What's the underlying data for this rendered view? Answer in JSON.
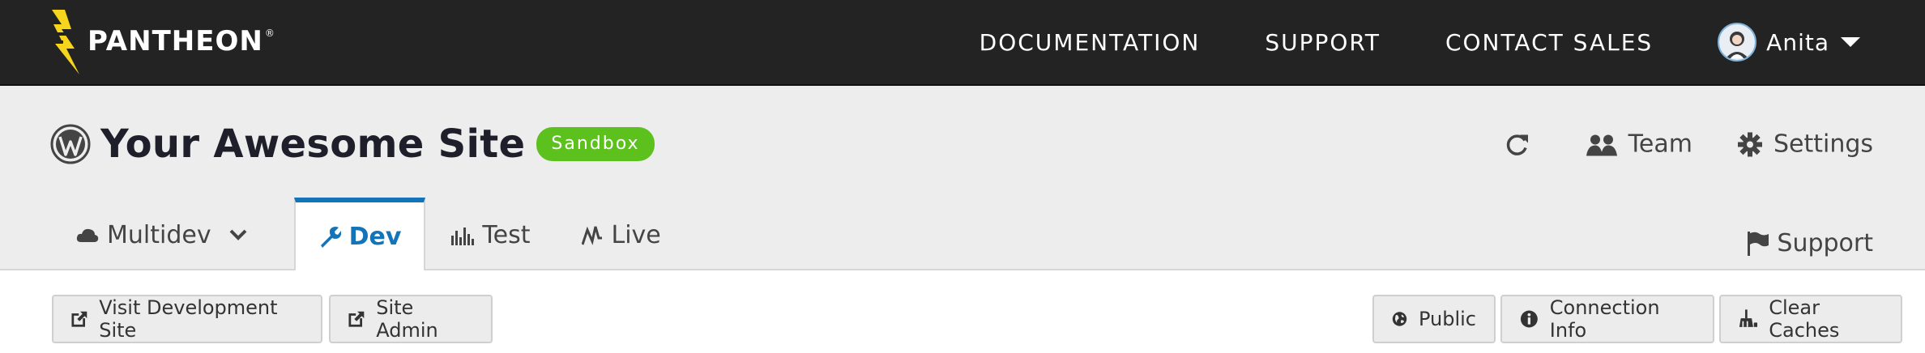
{
  "brand": {
    "name": "PANTHEON",
    "reg": "®"
  },
  "topnav": {
    "documentation": "DOCUMENTATION",
    "support": "SUPPORT",
    "contact_sales": "CONTACT SALES",
    "user_name": "Anita"
  },
  "site": {
    "title": "Your Awesome Site",
    "plan_badge": "Sandbox"
  },
  "header_actions": {
    "team": "Team",
    "settings": "Settings"
  },
  "tabs": [
    {
      "label": "Multidev",
      "icon": "cloud-icon"
    },
    {
      "label": "Dev",
      "icon": "wrench-icon",
      "active": true
    },
    {
      "label": "Test",
      "icon": "bar-chart-icon"
    },
    {
      "label": "Live",
      "icon": "pulse-icon"
    }
  ],
  "support_tab": "Support",
  "actions": {
    "visit_dev_site": "Visit Development Site",
    "site_admin": "Site Admin",
    "public": "Public",
    "connection_info": "Connection Info",
    "clear_caches": "Clear Caches"
  },
  "colors": {
    "topbar": "#232323",
    "accent_blue": "#1474b8",
    "sandbox_green": "#5cc11d",
    "logo_yellow": "#f7d51c"
  }
}
